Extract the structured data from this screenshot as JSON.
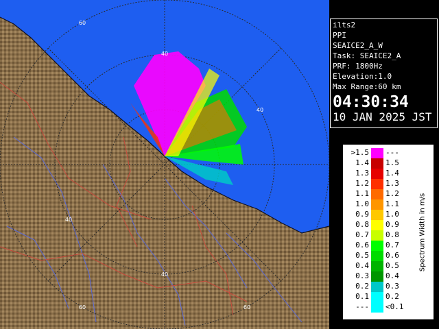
{
  "info": {
    "radar_name": "ilts2",
    "product": "PPI",
    "scan": "SEAICE2_A_W",
    "task": "Task: SEAICE2_A",
    "prf": "PRF: 1800Hz",
    "elevation": "Elevation:1.0",
    "max_range": "Max Range:60 km",
    "time": "04:30:34",
    "date": "10 JAN 2025 JST"
  },
  "range_rings": {
    "labels": [
      "40",
      "40",
      "40",
      "40",
      "60",
      "60",
      "60"
    ]
  },
  "legend": {
    "title": "Spectrum Width in m/s",
    "rows": [
      {
        "left": ">1.5",
        "right": "---",
        "color": "#ff00ff"
      },
      {
        "left": "1.4",
        "right": "1.5",
        "color": "#c80000"
      },
      {
        "left": "1.3",
        "right": "1.4",
        "color": "#e60000"
      },
      {
        "left": "1.2",
        "right": "1.3",
        "color": "#ff3000"
      },
      {
        "left": "1.1",
        "right": "1.2",
        "color": "#ff6a00"
      },
      {
        "left": "1.0",
        "right": "1.1",
        "color": "#ff9600"
      },
      {
        "left": "0.9",
        "right": "1.0",
        "color": "#ffc800"
      },
      {
        "left": "0.8",
        "right": "0.9",
        "color": "#ffff00"
      },
      {
        "left": "0.7",
        "right": "0.8",
        "color": "#c8ff00"
      },
      {
        "left": "0.6",
        "right": "0.7",
        "color": "#00ff00"
      },
      {
        "left": "0.5",
        "right": "0.6",
        "color": "#00dc00"
      },
      {
        "left": "0.4",
        "right": "0.5",
        "color": "#00b400"
      },
      {
        "left": "0.3",
        "right": "0.4",
        "color": "#009600"
      },
      {
        "left": "0.2",
        "right": "0.3",
        "color": "#00c8c8"
      },
      {
        "left": "0.1",
        "right": "0.2",
        "color": "#00ffff"
      },
      {
        "left": "---",
        "right": "<0.1",
        "color": "#00ffff"
      }
    ]
  },
  "colors": {
    "sea": "#1e5ef0",
    "land": "#8a6f4a",
    "rings": "#2a2a2a",
    "river": "#5a6ad8",
    "border": "#c84a3c"
  }
}
